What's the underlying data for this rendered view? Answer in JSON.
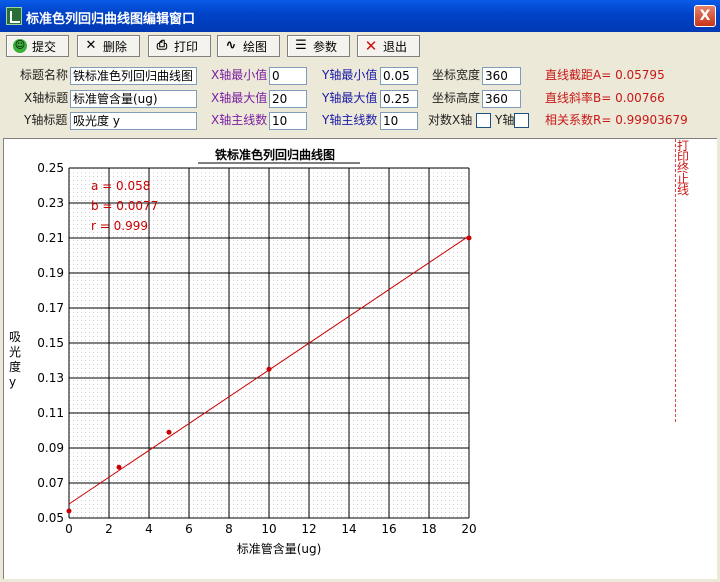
{
  "window": {
    "title": "标准色列回归曲线图编辑窗口",
    "close_symbol": "X"
  },
  "toolbar": {
    "submit": "提交",
    "delete": "删除",
    "print": "打印",
    "draw": "绘图",
    "params": "参数",
    "exit": "退出"
  },
  "params": {
    "title_label": "标题名称",
    "title_value": "铁标准色列回归曲线图",
    "xaxis_label": "X轴标题",
    "xaxis_value": "标准管含量(ug)",
    "yaxis_label": "Y轴标题",
    "yaxis_value": "吸光度 y",
    "xmin_label": "X轴最小值",
    "xmin_value": "0",
    "xmax_label": "X轴最大值",
    "xmax_value": "20",
    "xmain_label": "X轴主线数",
    "xmain_value": "10",
    "ymin_label": "Y轴最小值",
    "ymin_value": "0.05",
    "ymax_label": "Y轴最大值",
    "ymax_value": "0.25",
    "ymain_label": "Y轴主线数",
    "ymain_value": "10",
    "width_label": "坐标宽度",
    "width_value": "360",
    "height_label": "坐标高度",
    "height_value": "360",
    "logx_label": "对数X轴",
    "logy_label": "Y轴",
    "intercept": "直线截距A= 0.05795",
    "slope": "直线斜率B= 0.00766",
    "corr": "相关系数R= 0.99903679"
  },
  "print_stop_label": "打印终止线",
  "colors": {
    "series": "#cc0000",
    "label_purple": "#7b1fa2",
    "label_blue": "#1a1aa8",
    "result_red": "#c81818"
  },
  "chart_data": {
    "type": "scatter",
    "title": "铁标准色列回归曲线图",
    "xlabel": "标准管含量(ug)",
    "ylabel": "吸光度 y",
    "xlim": [
      0,
      20
    ],
    "ylim": [
      0.05,
      0.25
    ],
    "xticks": [
      "0",
      "2",
      "4",
      "6",
      "8",
      "10",
      "12",
      "14",
      "16",
      "18",
      "20"
    ],
    "yticks": [
      "0.05",
      "0.07",
      "0.09",
      "0.11",
      "0.13",
      "0.15",
      "0.17",
      "0.19",
      "0.21",
      "0.23",
      "0.25"
    ],
    "grid": true,
    "series": [
      {
        "type": "scatter",
        "x": [
          0,
          2.5,
          5,
          10,
          20
        ],
        "y": [
          0.054,
          0.079,
          0.099,
          0.135,
          0.21
        ]
      },
      {
        "type": "line",
        "x": [
          0,
          20
        ],
        "y": [
          0.058,
          0.2112
        ]
      }
    ],
    "annotations": [
      "a = 0.058",
      "b = 0.0077",
      "r = 0.999"
    ]
  }
}
